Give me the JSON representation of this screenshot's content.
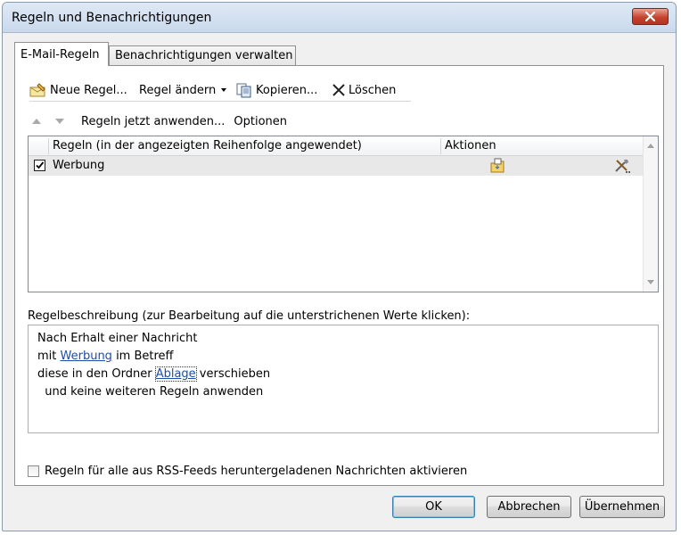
{
  "window": {
    "title": "Regeln und Benachrichtigungen"
  },
  "tabs": [
    {
      "label": "E-Mail-Regeln",
      "active": true
    },
    {
      "label": "Benachrichtigungen verwalten",
      "active": false
    }
  ],
  "toolbar": {
    "new_rule": "Neue Regel...",
    "change_rule": "Regel ändern",
    "copy": "Kopieren...",
    "delete": "Löschen"
  },
  "actionbar": {
    "apply_now": "Regeln jetzt anwenden...",
    "options": "Optionen"
  },
  "rules_list": {
    "column_rules": "Regeln (in der angezeigten Reihenfolge angewendet)",
    "column_actions": "Aktionen",
    "rows": [
      {
        "name": "Werbung",
        "enabled": true,
        "action_icons": [
          "move-to-folder-icon",
          "tools-icon"
        ]
      }
    ]
  },
  "description": {
    "label": "Regelbeschreibung (zur Bearbeitung auf die unterstrichenen Werte klicken):",
    "line1": "Nach Erhalt einer Nachricht",
    "line2_pre": "mit ",
    "line2_link": "Werbung",
    "line2_post": " im Betreff",
    "line3_pre": "diese in den Ordner ",
    "line3_link": "Ablage",
    "line3_post": " verschieben",
    "line4": "  und keine weiteren Regeln anwenden"
  },
  "rss_option": {
    "label": "Regeln für alle aus RSS-Feeds heruntergeladenen Nachrichten aktivieren",
    "checked": false
  },
  "buttons": {
    "ok": "OK",
    "cancel": "Abbrechen",
    "apply": "Übernehmen"
  },
  "colors": {
    "link": "#1a4ea8",
    "close_button": "#c7432f",
    "selected_row": "#e8e8e8"
  }
}
